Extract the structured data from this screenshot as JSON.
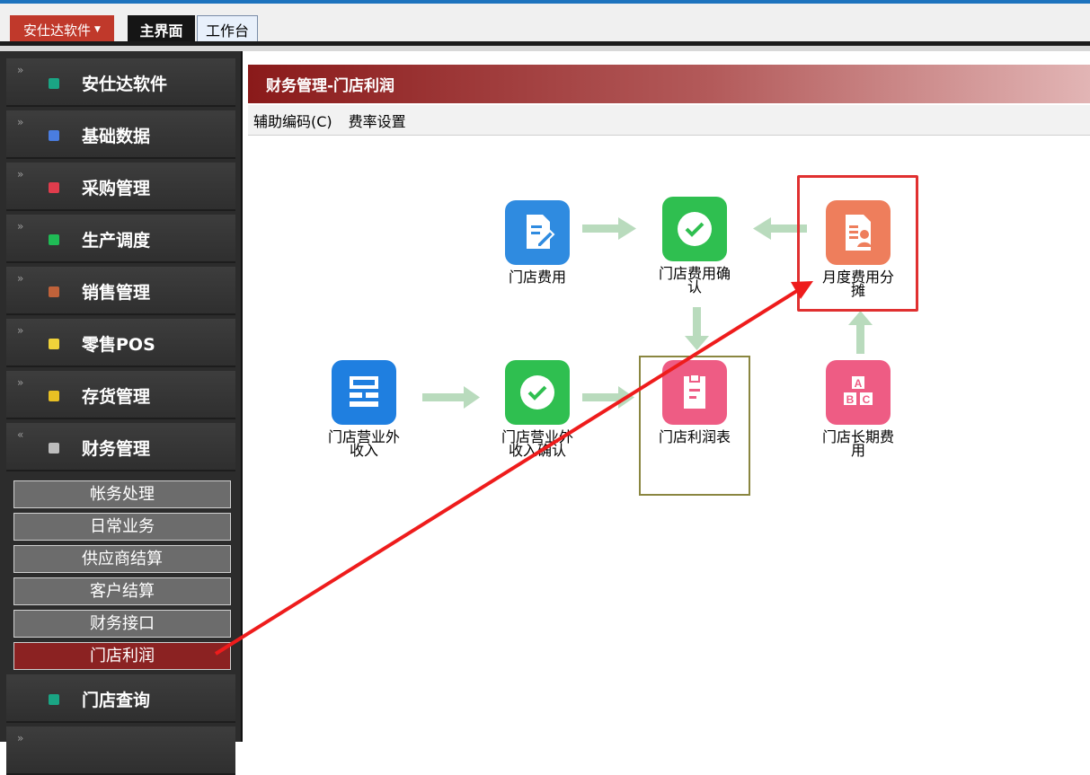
{
  "topbar": {
    "app_menu": "安仕达软件",
    "tabs": [
      "主界面",
      "工作台"
    ]
  },
  "sidebar": {
    "items": [
      {
        "label": "安仕达软件",
        "bullet": "#1aa584"
      },
      {
        "label": "基础数据",
        "bullet": "#4a7de0"
      },
      {
        "label": "采购管理",
        "bullet": "#e03c4c"
      },
      {
        "label": "生产调度",
        "bullet": "#1fbb55"
      },
      {
        "label": "销售管理",
        "bullet": "#c0623a"
      },
      {
        "label": "零售POS",
        "bullet": "#f0d23a"
      },
      {
        "label": "存货管理",
        "bullet": "#e8c024"
      },
      {
        "label": "财务管理",
        "bullet": "#bdbdbd"
      }
    ],
    "sub_items": [
      "帐务处理",
      "日常业务",
      "供应商结算",
      "客户结算",
      "财务接口",
      "门店利润"
    ],
    "active_sub": "门店利润",
    "after_items": [
      {
        "label": "门店查询",
        "bullet": "#1aa584"
      }
    ]
  },
  "content": {
    "title": "财务管理-门店利润",
    "toolbar": [
      "辅助编码(C)",
      "费率设置"
    ],
    "nodes": {
      "store_expense": {
        "label": "门店费用",
        "color": "#2f8be0"
      },
      "store_expense_confirm": {
        "label": "门店费用确\n认",
        "color": "#2fbf50"
      },
      "monthly_allocation": {
        "label": "月度费用分\n摊",
        "color": "#ee7e5c"
      },
      "store_other_income": {
        "label": "门店营业外\n收入",
        "color": "#1f7fe0"
      },
      "store_other_income_confirm": {
        "label": "门店营业外\n收入确认",
        "color": "#2fbf50"
      },
      "store_profit_table": {
        "label": "门店利润表",
        "color": "#ee5c84"
      },
      "store_long_term_expense": {
        "label": "门店长期费\n用",
        "color": "#ee5c84"
      }
    }
  }
}
